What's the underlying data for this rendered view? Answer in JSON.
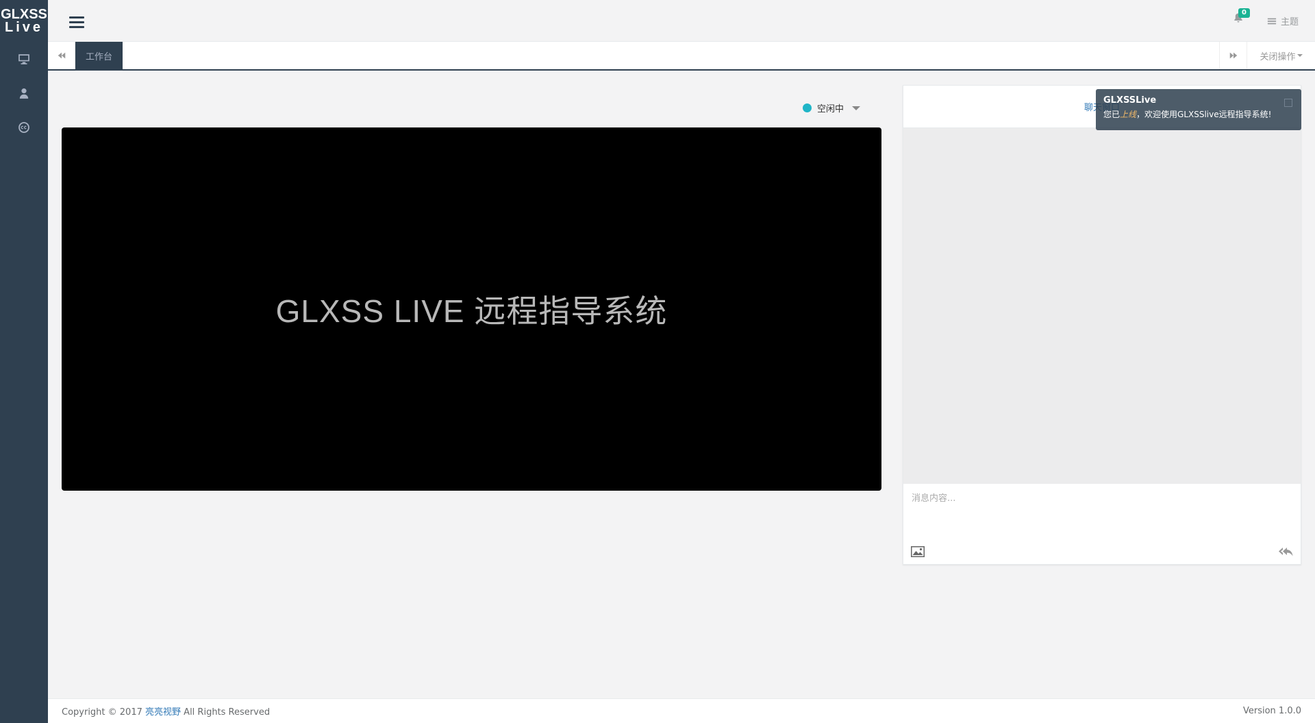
{
  "app": {
    "logo_line1": "GLXSS",
    "logo_line2": "Live"
  },
  "sidebar": {
    "items": [
      {
        "icon": "monitor-icon"
      },
      {
        "icon": "user-icon"
      },
      {
        "icon": "cc-icon"
      }
    ]
  },
  "header": {
    "notification_count": "0",
    "theme_label": "主题"
  },
  "tabs": {
    "active_label": "工作台",
    "close_ops_label": "关闭操作"
  },
  "status": {
    "label": "空闲中",
    "color": "#1fb5c7"
  },
  "video": {
    "title": "GLXSS LIVE 远程指导系统"
  },
  "chat": {
    "header_label": "聊天窗口",
    "placeholder": "消息内容..."
  },
  "toast": {
    "title": "GLXSSLive",
    "msg_prefix": "您已",
    "msg_highlight": "上线",
    "msg_suffix": "，欢迎使用GLXSSlive远程指导系统!"
  },
  "footer": {
    "copyright_prefix": "Copyright © 2017",
    "company": "亮亮视野",
    "copyright_suffix": "All Rights Reserved",
    "version": "Version 1.0.0"
  }
}
